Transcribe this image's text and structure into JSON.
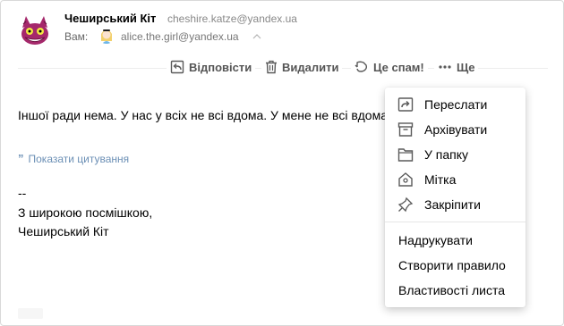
{
  "colors": {
    "link": "#6b8fb5",
    "muted": "#888888",
    "toolbar_text": "#555555",
    "icon": "#5a5a5a"
  },
  "header": {
    "sender_name": "Чеширський Кіт",
    "sender_email": "cheshire.katze@yandex.ua",
    "to_label": "Вам:",
    "to_email": "alice.the.girl@yandex.ua"
  },
  "toolbar": {
    "reply_label": "Відповісти",
    "delete_label": "Видалити",
    "spam_label": "Це спам!",
    "more_label": "Ще"
  },
  "message": {
    "text": "Іншої ради нема. У нас у всіх не всі вдома. У мене не всі вдома. І в тебе не всі вдома.",
    "show_quote_label": "Показати цитування",
    "signature": [
      "--",
      "З широкою посмішкою,",
      "Чеширський Кіт"
    ]
  },
  "more_menu": {
    "items": [
      {
        "label": "Переслати",
        "icon": "forward-icon"
      },
      {
        "label": "Архівувати",
        "icon": "archive-icon"
      },
      {
        "label": "У папку",
        "icon": "folder-icon"
      },
      {
        "label": "Мітка",
        "icon": "tag-icon"
      },
      {
        "label": "Закріпити",
        "icon": "pin-icon"
      }
    ],
    "plain_items": [
      "Надрукувати",
      "Створити правило",
      "Властивості листа"
    ]
  }
}
